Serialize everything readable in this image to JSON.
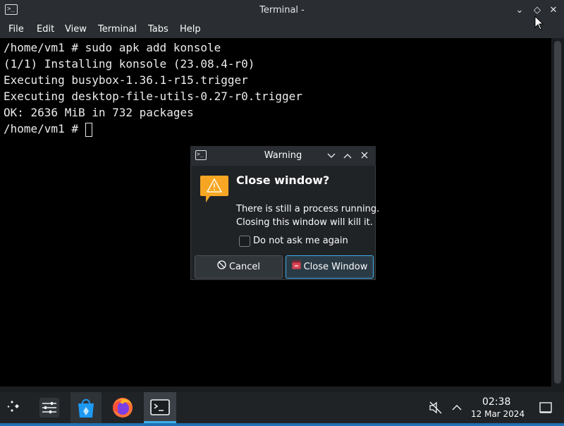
{
  "window": {
    "title": "Terminal -",
    "controls": {
      "minimize": "⌄",
      "maximize": "◇",
      "close": "✕"
    }
  },
  "menu": [
    "File",
    "Edit",
    "View",
    "Terminal",
    "Tabs",
    "Help"
  ],
  "terminal": {
    "lines": [
      "/home/vm1 # sudo apk add konsole",
      "(1/1) Installing konsole (23.08.4-r0)",
      "Executing busybox-1.36.1-r15.trigger",
      "Executing desktop-file-utils-0.27-r0.trigger",
      "OK: 2636 MiB in 732 packages"
    ],
    "prompt": "/home/vm1 # "
  },
  "dialog": {
    "title": "Warning",
    "heading": "Close window?",
    "message_line1": "There is still a process running.",
    "message_line2": "Closing this window will kill it.",
    "checkbox_label": "Do not ask me again",
    "checkbox_checked": false,
    "cancel_label": "Cancel",
    "close_label": "Close Window",
    "accent_color": "#3daee9",
    "warning_color": "#f6a623"
  },
  "taskbar": {
    "items": [
      "application-launcher-icon",
      "settings-icon",
      "discover-store-icon",
      "firefox-icon",
      "terminal-icon"
    ],
    "clock_time": "02:38",
    "clock_date": "12 Mar 2024"
  }
}
